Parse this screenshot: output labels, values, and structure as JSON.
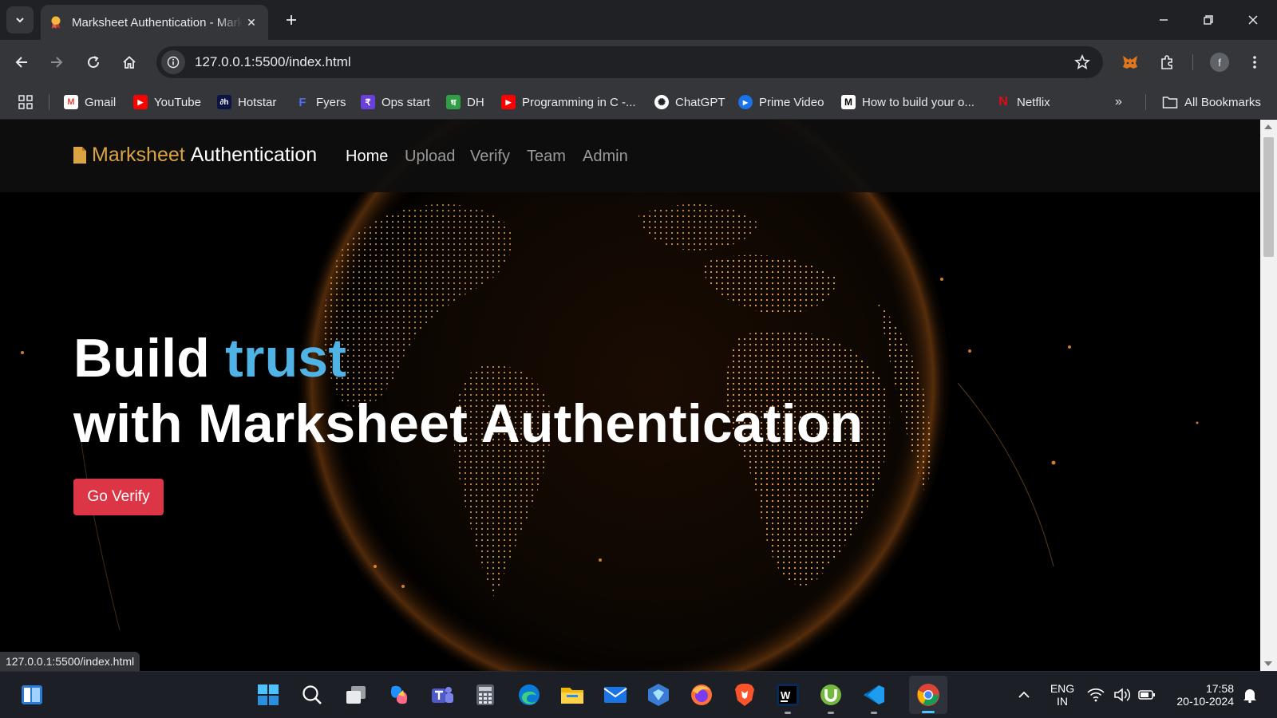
{
  "browser": {
    "tab_title": "Marksheet Authentication - Marksheet Authentication",
    "url": "127.0.0.1:5500/index.html",
    "profile_initial": "f",
    "bookmarks": [
      {
        "label": "Gmail",
        "icon": "gmail-icon",
        "color": "#ea4335",
        "glyph": "M"
      },
      {
        "label": "YouTube",
        "icon": "youtube-icon",
        "color": "#ff0000",
        "glyph": "▶"
      },
      {
        "label": "Hotstar",
        "icon": "hotstar-icon",
        "color": "#0c1445",
        "glyph": "∂h"
      },
      {
        "label": "Fyers",
        "icon": "fyers-icon",
        "color": "#3b5bdb",
        "glyph": "F"
      },
      {
        "label": "Ops start",
        "icon": "ops-start-icon",
        "color": "#6741d9",
        "glyph": "₹"
      },
      {
        "label": "DH",
        "icon": "dh-icon",
        "color": "#2f9e44",
        "glyph": "ध"
      },
      {
        "label": "Programming in C -...",
        "icon": "youtube-icon",
        "color": "#ff0000",
        "glyph": "▶"
      },
      {
        "label": "ChatGPT",
        "icon": "chatgpt-icon",
        "color": "#202124",
        "glyph": "✺"
      },
      {
        "label": "Prime Video",
        "icon": "prime-video-icon",
        "color": "#1a73e8",
        "glyph": "▶"
      },
      {
        "label": "How to build your o...",
        "icon": "medium-icon",
        "color": "#ffffff",
        "glyph": "M"
      },
      {
        "label": "Netflix",
        "icon": "netflix-icon",
        "color": "#202124",
        "glyph": "N"
      }
    ],
    "all_bookmarks": "All Bookmarks",
    "status_url": "127.0.0.1:5500/index.html"
  },
  "page": {
    "brand_part1": "Marksheet",
    "brand_part2": "Authentication",
    "nav": [
      "Home",
      "Upload",
      "Verify",
      "Team",
      "Admin"
    ],
    "active_nav": "Home",
    "hero_line1_a": "Build",
    "hero_line1_b": "trust",
    "hero_line2": "with Marksheet Authentication",
    "cta_label": "Go Verify",
    "colors": {
      "brand_gold": "#d9a441",
      "accent_blue": "#4fb3e6",
      "cta_red": "#dc3545"
    }
  },
  "taskbar": {
    "apps": [
      "start-icon",
      "search-icon",
      "task-view-icon",
      "copilot-icon",
      "teams-icon",
      "calculator-icon",
      "edge-icon",
      "file-explorer-icon",
      "mail-icon",
      "app-icon",
      "firefox-icon",
      "brave-icon",
      "webstorm-icon",
      "utorrent-icon",
      "vscode-icon",
      "chrome-icon"
    ],
    "lang_line1": "ENG",
    "lang_line2": "IN",
    "time": "17:58",
    "date": "20-10-2024"
  }
}
